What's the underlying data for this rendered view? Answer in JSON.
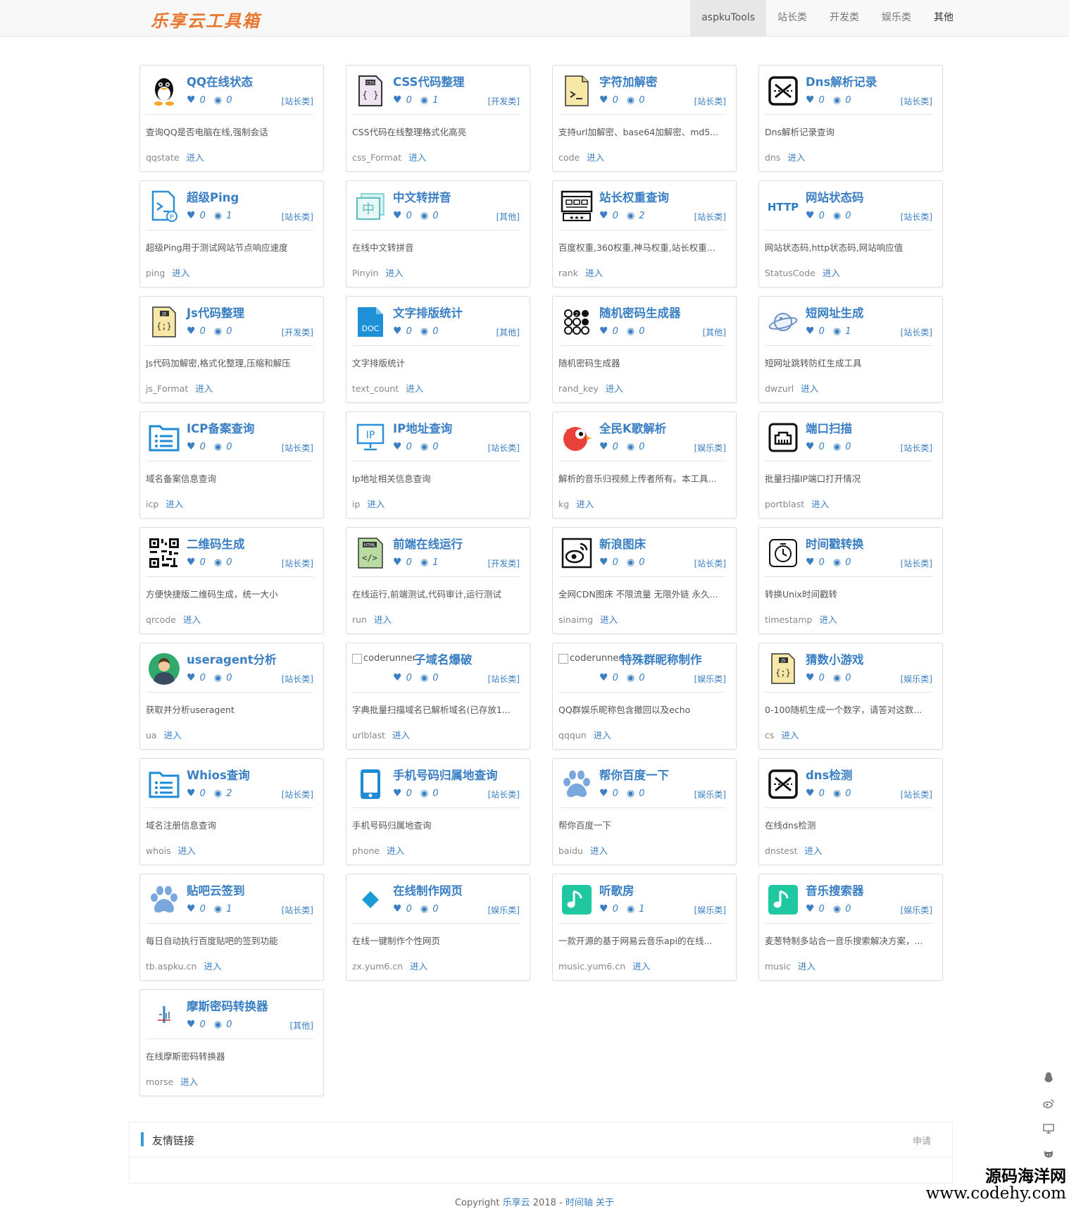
{
  "header": {
    "logo": "乐享云工具箱",
    "nav": [
      "aspkuTools",
      "站长类",
      "开发类",
      "娱乐类",
      "其他"
    ]
  },
  "colors": {
    "accent": "#3a7fc4",
    "logo": "#e8762d",
    "nav_active_bg": "#e7e7e7"
  },
  "tools": [
    {
      "title": "QQ在线状态",
      "likes": "0",
      "views": "0",
      "category": "[站长类]",
      "desc": "查询QQ是否电脑在线,强制会话",
      "slug": "qqstate",
      "icon": "qq-penguin-icon"
    },
    {
      "title": "CSS代码整理",
      "likes": "0",
      "views": "1",
      "category": "[开发类]",
      "desc": "CSS代码在线整理格式化高亮",
      "slug": "css_Format",
      "icon": "css-file-icon"
    },
    {
      "title": "字符加解密",
      "likes": "0",
      "views": "0",
      "category": "[站长类]",
      "desc": "支持url加解密、base64加解密、md5...",
      "slug": "code",
      "icon": "terminal-file-icon"
    },
    {
      "title": "Dns解析记录",
      "likes": "0",
      "views": "0",
      "category": "[站长类]",
      "desc": "Dns解析记录查询",
      "slug": "dns",
      "icon": "dns-icon"
    },
    {
      "title": "超级Ping",
      "likes": "0",
      "views": "1",
      "category": "[站长类]",
      "desc": "超级Ping用于测试网站节点响应速度",
      "slug": "ping",
      "icon": "ping-icon"
    },
    {
      "title": "中文转拼音",
      "likes": "0",
      "views": "0",
      "category": "[其他]",
      "desc": "在线中文转拼音",
      "slug": "Pinyin",
      "icon": "pinyin-icon"
    },
    {
      "title": "站长权重查询",
      "likes": "0",
      "views": "2",
      "category": "[站长类]",
      "desc": "百度权重,360权重,神马权重,站长权重...",
      "slug": "rank",
      "icon": "rank-icon"
    },
    {
      "title": "网站状态码",
      "likes": "0",
      "views": "0",
      "category": "[站长类]",
      "desc": "网站状态码,http状态码,网站响应值",
      "slug": "StatusCode",
      "icon": "http-icon"
    },
    {
      "title": "Js代码整理",
      "likes": "0",
      "views": "0",
      "category": "[开发类]",
      "desc": "Js代码加解密,格式化整理,压缩和解压",
      "slug": "js_Format",
      "icon": "js-file-icon"
    },
    {
      "title": "文字排版统计",
      "likes": "0",
      "views": "0",
      "category": "[其他]",
      "desc": "文字排版统计",
      "slug": "text_count",
      "icon": "doc-icon"
    },
    {
      "title": "随机密码生成器",
      "likes": "0",
      "views": "0",
      "category": "[其他]",
      "desc": "随机密码生成器",
      "slug": "rand_key",
      "icon": "password-dots-icon"
    },
    {
      "title": "短网址生成",
      "likes": "0",
      "views": "1",
      "category": "[站长类]",
      "desc": "短网址跳转防红生成工具",
      "slug": "dwzurl",
      "icon": "planet-icon"
    },
    {
      "title": "ICP备案查询",
      "likes": "0",
      "views": "0",
      "category": "[站长类]",
      "desc": "域名备案信息查询",
      "slug": "icp",
      "icon": "folder-list-icon"
    },
    {
      "title": "IP地址查询",
      "likes": "0",
      "views": "0",
      "category": "[站长类]",
      "desc": "Ip地址相关信息查询",
      "slug": "ip",
      "icon": "ip-monitor-icon"
    },
    {
      "title": "全民K歌解析",
      "likes": "0",
      "views": "0",
      "category": "[娱乐类]",
      "desc": "解析的音乐归视频上传者所有。本工具...",
      "slug": "kg",
      "icon": "kge-bird-icon"
    },
    {
      "title": "端口扫描",
      "likes": "0",
      "views": "0",
      "category": "[站长类]",
      "desc": "批量扫描IP端口打开情况",
      "slug": "portblast",
      "icon": "ethernet-port-icon"
    },
    {
      "title": "二维码生成",
      "likes": "0",
      "views": "0",
      "category": "[站长类]",
      "desc": "方便快捷版二维码生成，统一大小",
      "slug": "qrcode",
      "icon": "qrcode-icon"
    },
    {
      "title": "前端在线运行",
      "likes": "0",
      "views": "1",
      "category": "[开发类]",
      "desc": "在线运行,前端测试,代码审计,运行测试",
      "slug": "run",
      "icon": "html-file-icon"
    },
    {
      "title": "新浪图床",
      "likes": "0",
      "views": "0",
      "category": "[站长类]",
      "desc": "全网CDN图床 不限流量 无限外链 永久...",
      "slug": "sinaimg",
      "icon": "weibo-icon"
    },
    {
      "title": "时间戳转换",
      "likes": "0",
      "views": "0",
      "category": "[站长类]",
      "desc": "转换Unix时间戳转",
      "slug": "timestamp",
      "icon": "clock-icon"
    },
    {
      "title": "useragent分析",
      "likes": "0",
      "views": "0",
      "category": "[站长类]",
      "desc": "获取并分析useragent",
      "slug": "ua",
      "icon": "user-avatar-icon"
    },
    {
      "title": "子域名爆破",
      "likes": "0",
      "views": "0",
      "category": "[站长类]",
      "desc": "字典批量扫描域名已解析域名(已存放1...",
      "slug": "urlblast",
      "icon": "broken-image-icon",
      "alt": "coderunner"
    },
    {
      "title": "特殊群昵称制作",
      "likes": "0",
      "views": "0",
      "category": "[娱乐类]",
      "desc": "QQ群娱乐昵称包含撤回以及echo",
      "slug": "qqqun",
      "icon": "broken-image-icon",
      "alt": "coderunner"
    },
    {
      "title": "猜数小游戏",
      "likes": "0",
      "views": "0",
      "category": "[娱乐类]",
      "desc": "0-100随机生成一个数字，请答对这数...",
      "slug": "cs",
      "icon": "js-file-icon"
    },
    {
      "title": "Whios查询",
      "likes": "0",
      "views": "2",
      "category": "[站长类]",
      "desc": "域名注册信息查询",
      "slug": "whois",
      "icon": "folder-list-icon"
    },
    {
      "title": "手机号码归属地查询",
      "likes": "0",
      "views": "0",
      "category": "[站长类]",
      "desc": "手机号码归属地查询",
      "slug": "phone",
      "icon": "phone-icon"
    },
    {
      "title": "帮你百度一下",
      "likes": "0",
      "views": "0",
      "category": "[娱乐类]",
      "desc": "帮你百度一下",
      "slug": "baidu",
      "icon": "paw-icon"
    },
    {
      "title": "dns检测",
      "likes": "0",
      "views": "0",
      "category": "[站长类]",
      "desc": "在线dns检测",
      "slug": "dnstest",
      "icon": "dns-icon"
    },
    {
      "title": "贴吧云签到",
      "likes": "0",
      "views": "1",
      "category": "[站长类]",
      "desc": "每日自动执行百度贴吧的签到功能",
      "slug": "tb.aspku.cn",
      "icon": "paw-icon"
    },
    {
      "title": "在线制作网页",
      "likes": "0",
      "views": "0",
      "category": "[娱乐类]",
      "desc": "在线一键制作个性网页",
      "slug": "zx.yum6.cn",
      "icon": "diamond-icon"
    },
    {
      "title": "听歌房",
      "likes": "0",
      "views": "1",
      "category": "[娱乐类]",
      "desc": "一款开源的基于网易云音乐api的在线...",
      "slug": "music.yum6.cn",
      "icon": "music-note-icon"
    },
    {
      "title": "音乐搜索器",
      "likes": "0",
      "views": "0",
      "category": "[娱乐类]",
      "desc": "麦葱特制多站合一音乐搜索解决方案，...",
      "slug": "music",
      "icon": "music-note-icon"
    },
    {
      "title": "摩斯密码转换器",
      "likes": "0",
      "views": "0",
      "category": "[其他]",
      "desc": "在线摩斯密码转换器",
      "slug": "morse",
      "icon": "morse-icon"
    }
  ],
  "enter_label": "进入",
  "friends": {
    "title": "友情链接",
    "apply": "申请"
  },
  "footer": {
    "prefix": "Copyright ",
    "site": "乐享云",
    "year": " 2018 - ",
    "timeline": "时间轴",
    "about": "关于"
  },
  "side_icons": [
    "qq-icon",
    "weibo-icon",
    "monitor-icon",
    "github-icon"
  ],
  "watermark": {
    "line1": "源码海洋网",
    "line2": "www.codehy.com"
  }
}
